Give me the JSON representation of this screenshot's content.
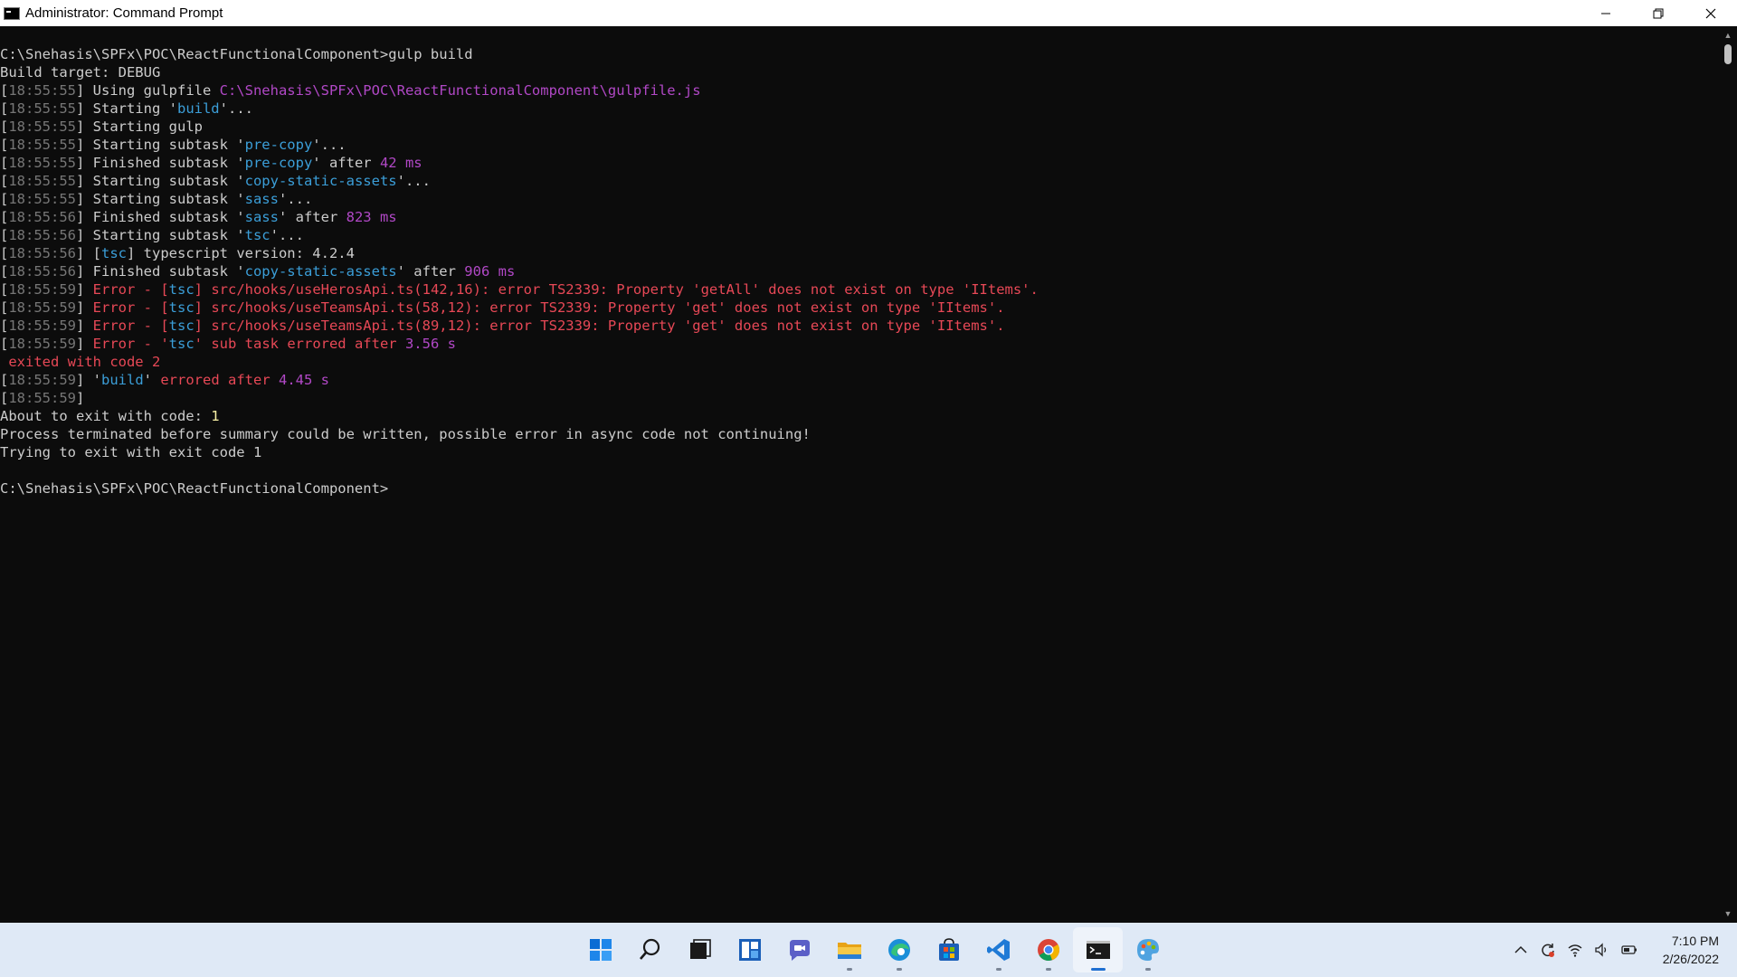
{
  "window": {
    "title": "Administrator: Command Prompt"
  },
  "console_lines": [
    [
      {
        "t": "C:\\Snehasis\\SPFx\\POC\\ReactFunctionalComponent>gulp build",
        "c": "gray"
      }
    ],
    [
      {
        "t": "Build target: DEBUG",
        "c": "gray"
      }
    ],
    [
      {
        "t": "[",
        "c": "gray"
      },
      {
        "t": "18:55:55",
        "c": "dim"
      },
      {
        "t": "] Using gulpfile ",
        "c": "gray"
      },
      {
        "t": "C:\\Snehasis\\SPFx\\POC\\ReactFunctionalComponent\\gulpfile.js",
        "c": "mag"
      }
    ],
    [
      {
        "t": "[",
        "c": "gray"
      },
      {
        "t": "18:55:55",
        "c": "dim"
      },
      {
        "t": "] Starting '",
        "c": "gray"
      },
      {
        "t": "build",
        "c": "cyan"
      },
      {
        "t": "'...",
        "c": "gray"
      }
    ],
    [
      {
        "t": "[",
        "c": "gray"
      },
      {
        "t": "18:55:55",
        "c": "dim"
      },
      {
        "t": "] Starting gulp",
        "c": "gray"
      }
    ],
    [
      {
        "t": "[",
        "c": "gray"
      },
      {
        "t": "18:55:55",
        "c": "dim"
      },
      {
        "t": "] Starting subtask '",
        "c": "gray"
      },
      {
        "t": "pre-copy",
        "c": "cyan"
      },
      {
        "t": "'...",
        "c": "gray"
      }
    ],
    [
      {
        "t": "[",
        "c": "gray"
      },
      {
        "t": "18:55:55",
        "c": "dim"
      },
      {
        "t": "] Finished subtask '",
        "c": "gray"
      },
      {
        "t": "pre-copy",
        "c": "cyan"
      },
      {
        "t": "' after ",
        "c": "gray"
      },
      {
        "t": "42 ms",
        "c": "mag"
      }
    ],
    [
      {
        "t": "[",
        "c": "gray"
      },
      {
        "t": "18:55:55",
        "c": "dim"
      },
      {
        "t": "] Starting subtask '",
        "c": "gray"
      },
      {
        "t": "copy-static-assets",
        "c": "cyan"
      },
      {
        "t": "'...",
        "c": "gray"
      }
    ],
    [
      {
        "t": "[",
        "c": "gray"
      },
      {
        "t": "18:55:55",
        "c": "dim"
      },
      {
        "t": "] Starting subtask '",
        "c": "gray"
      },
      {
        "t": "sass",
        "c": "cyan"
      },
      {
        "t": "'...",
        "c": "gray"
      }
    ],
    [
      {
        "t": "[",
        "c": "gray"
      },
      {
        "t": "18:55:56",
        "c": "dim"
      },
      {
        "t": "] Finished subtask '",
        "c": "gray"
      },
      {
        "t": "sass",
        "c": "cyan"
      },
      {
        "t": "' after ",
        "c": "gray"
      },
      {
        "t": "823 ms",
        "c": "mag"
      }
    ],
    [
      {
        "t": "[",
        "c": "gray"
      },
      {
        "t": "18:55:56",
        "c": "dim"
      },
      {
        "t": "] Starting subtask '",
        "c": "gray"
      },
      {
        "t": "tsc",
        "c": "cyan"
      },
      {
        "t": "'...",
        "c": "gray"
      }
    ],
    [
      {
        "t": "[",
        "c": "gray"
      },
      {
        "t": "18:55:56",
        "c": "dim"
      },
      {
        "t": "] [",
        "c": "gray"
      },
      {
        "t": "tsc",
        "c": "cyan"
      },
      {
        "t": "] typescript version: 4.2.4",
        "c": "gray"
      }
    ],
    [
      {
        "t": "[",
        "c": "gray"
      },
      {
        "t": "18:55:56",
        "c": "dim"
      },
      {
        "t": "] Finished subtask '",
        "c": "gray"
      },
      {
        "t": "copy-static-assets",
        "c": "cyan"
      },
      {
        "t": "' after ",
        "c": "gray"
      },
      {
        "t": "906 ms",
        "c": "mag"
      }
    ],
    [
      {
        "t": "[",
        "c": "gray"
      },
      {
        "t": "18:55:59",
        "c": "dim"
      },
      {
        "t": "] ",
        "c": "gray"
      },
      {
        "t": "Error - [",
        "c": "red"
      },
      {
        "t": "tsc",
        "c": "cyan"
      },
      {
        "t": "] src/hooks/useHerosApi.ts(142,16): error TS2339: Property 'getAll' does not exist on type 'IItems'.",
        "c": "red"
      }
    ],
    [
      {
        "t": "[",
        "c": "gray"
      },
      {
        "t": "18:55:59",
        "c": "dim"
      },
      {
        "t": "] ",
        "c": "gray"
      },
      {
        "t": "Error - [",
        "c": "red"
      },
      {
        "t": "tsc",
        "c": "cyan"
      },
      {
        "t": "] src/hooks/useTeamsApi.ts(58,12): error TS2339: Property 'get' does not exist on type 'IItems'.",
        "c": "red"
      }
    ],
    [
      {
        "t": "[",
        "c": "gray"
      },
      {
        "t": "18:55:59",
        "c": "dim"
      },
      {
        "t": "] ",
        "c": "gray"
      },
      {
        "t": "Error - [",
        "c": "red"
      },
      {
        "t": "tsc",
        "c": "cyan"
      },
      {
        "t": "] src/hooks/useTeamsApi.ts(89,12): error TS2339: Property 'get' does not exist on type 'IItems'.",
        "c": "red"
      }
    ],
    [
      {
        "t": "[",
        "c": "gray"
      },
      {
        "t": "18:55:59",
        "c": "dim"
      },
      {
        "t": "] ",
        "c": "gray"
      },
      {
        "t": "Error - '",
        "c": "red"
      },
      {
        "t": "tsc",
        "c": "cyan"
      },
      {
        "t": "' sub task errored after ",
        "c": "red"
      },
      {
        "t": "3.56 s",
        "c": "mag"
      }
    ],
    [
      {
        "t": " exited with code 2",
        "c": "red"
      }
    ],
    [
      {
        "t": "[",
        "c": "gray"
      },
      {
        "t": "18:55:59",
        "c": "dim"
      },
      {
        "t": "] '",
        "c": "gray"
      },
      {
        "t": "build",
        "c": "cyan"
      },
      {
        "t": "' ",
        "c": "gray"
      },
      {
        "t": "errored after ",
        "c": "red"
      },
      {
        "t": "4.45 s",
        "c": "mag"
      }
    ],
    [
      {
        "t": "[",
        "c": "gray"
      },
      {
        "t": "18:55:59",
        "c": "dim"
      },
      {
        "t": "]",
        "c": "gray"
      }
    ],
    [
      {
        "t": "About to exit with code: ",
        "c": "gray"
      },
      {
        "t": "1",
        "c": "yellow"
      }
    ],
    [
      {
        "t": "Process terminated before summary could be written, possible error in async code not continuing!",
        "c": "gray"
      }
    ],
    [
      {
        "t": "Trying to exit with exit code 1",
        "c": "gray"
      }
    ],
    [
      {
        "t": "",
        "c": "gray"
      }
    ],
    [
      {
        "t": "C:\\Snehasis\\SPFx\\POC\\ReactFunctionalComponent>",
        "c": "gray"
      }
    ]
  ],
  "taskbar": {
    "apps": [
      {
        "name": "start-button",
        "icon": "windows-logo-icon",
        "active": false,
        "running": false
      },
      {
        "name": "search-button",
        "icon": "search-icon",
        "active": false,
        "running": false
      },
      {
        "name": "task-view-button",
        "icon": "task-view-icon",
        "active": false,
        "running": false
      },
      {
        "name": "widgets-button",
        "icon": "widgets-icon",
        "active": false,
        "running": false
      },
      {
        "name": "chat-button",
        "icon": "chat-icon",
        "active": false,
        "running": false
      },
      {
        "name": "file-explorer-button",
        "icon": "folder-icon",
        "active": false,
        "running": true
      },
      {
        "name": "edge-button",
        "icon": "edge-icon",
        "active": false,
        "running": true
      },
      {
        "name": "store-button",
        "icon": "store-icon",
        "active": false,
        "running": false
      },
      {
        "name": "vscode-button",
        "icon": "vscode-icon",
        "active": false,
        "running": true
      },
      {
        "name": "chrome-button",
        "icon": "chrome-icon",
        "active": false,
        "running": true
      },
      {
        "name": "command-prompt-button",
        "icon": "terminal-icon",
        "active": true,
        "running": true
      },
      {
        "name": "paint-button",
        "icon": "palette-icon",
        "active": false,
        "running": true
      }
    ],
    "tray": [
      "chevron-up-icon",
      "sync-icon",
      "wifi-icon",
      "speaker-icon",
      "battery-icon"
    ],
    "clock": {
      "time": "7:10 PM",
      "date": "2/26/2022"
    }
  },
  "colors": {
    "console_bg": "#0c0c0c",
    "text": "#cccccc",
    "dim": "#767676",
    "magenta": "#b148c6",
    "cyan": "#3b9ed8",
    "red": "#e74856",
    "yellow": "#f9f1a5",
    "taskbar_bg": "#dfe9f6"
  }
}
